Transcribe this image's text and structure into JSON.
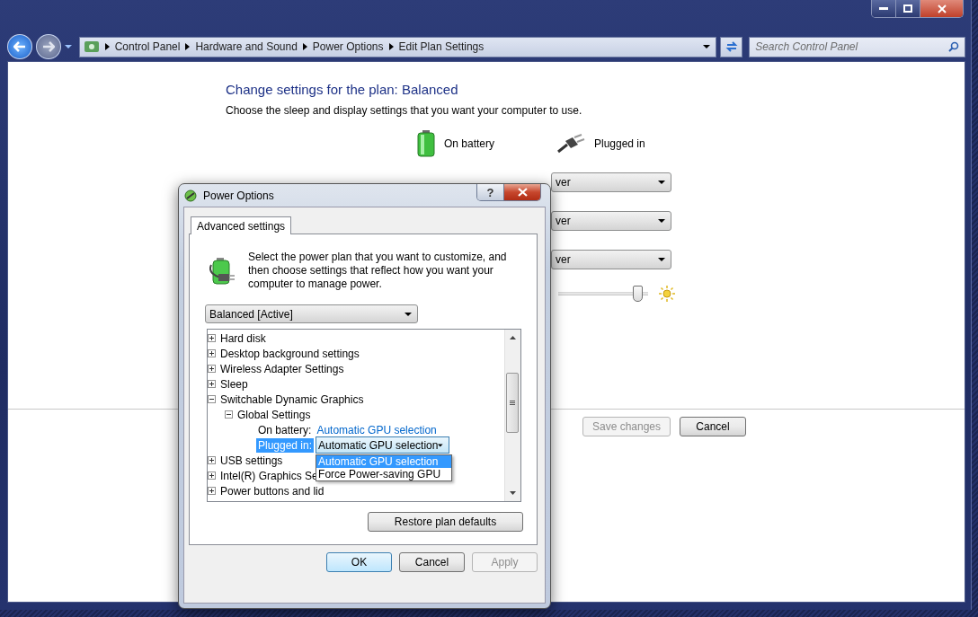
{
  "address_bar": {
    "crumbs": [
      "Control Panel",
      "Hardware and Sound",
      "Power Options",
      "Edit Plan Settings"
    ]
  },
  "search": {
    "placeholder": "Search Control Panel"
  },
  "page": {
    "title": "Change settings for the plan: Balanced",
    "subtitle": "Choose the sleep and display settings that you want your computer to use.",
    "columns": [
      {
        "kind": "battery",
        "label": "On battery"
      },
      {
        "kind": "plug",
        "label": "Plugged in"
      }
    ],
    "plugged_in_dropdowns": [
      "ver",
      "ver",
      "ver"
    ],
    "brightness": {
      "level": 0.88
    },
    "buttons": [
      {
        "label": "Save changes",
        "disabled": true
      },
      {
        "label": "Cancel",
        "disabled": false
      }
    ]
  },
  "dialog": {
    "title": "Power Options",
    "help_button": "?",
    "tabs": [
      {
        "label": "Advanced settings",
        "selected": true
      }
    ],
    "description": "Select the power plan that you want to customize, and then choose settings that reflect how you want your computer to manage power.",
    "plan": "Balanced [Active]",
    "tree": [
      {
        "kind": "group",
        "label": "Hard disk",
        "expanded": false
      },
      {
        "kind": "group",
        "label": "Desktop background settings",
        "expanded": false
      },
      {
        "kind": "group",
        "label": "Wireless Adapter Settings",
        "expanded": false
      },
      {
        "kind": "group",
        "label": "Sleep",
        "expanded": false
      },
      {
        "kind": "group",
        "label": "Switchable Dynamic Graphics",
        "expanded": true,
        "children": [
          {
            "kind": "group",
            "label": "Global Settings",
            "expanded": true,
            "children": [
              {
                "kind": "setting",
                "label": "On battery:",
                "value": "Automatic GPU selection",
                "selected": false
              },
              {
                "kind": "setting",
                "label": "Plugged in:",
                "value": "Automatic GPU selection",
                "selected": true,
                "open": true,
                "options": [
                  {
                    "label": "Automatic GPU selection",
                    "selected": true
                  },
                  {
                    "label": "Force Power-saving GPU",
                    "selected": false
                  }
                ]
              }
            ]
          }
        ]
      },
      {
        "kind": "group",
        "label": "USB settings",
        "expanded": false
      },
      {
        "kind": "group",
        "label": "Intel(R) Graphics Se",
        "expanded": false
      },
      {
        "kind": "group",
        "label": "Power buttons and lid",
        "expanded": false
      }
    ],
    "restore_button": "Restore plan defaults",
    "buttons": [
      {
        "label": "OK",
        "default": true,
        "disabled": false
      },
      {
        "label": "Cancel",
        "default": false,
        "disabled": false
      },
      {
        "label": "Apply",
        "default": false,
        "disabled": true
      }
    ]
  }
}
